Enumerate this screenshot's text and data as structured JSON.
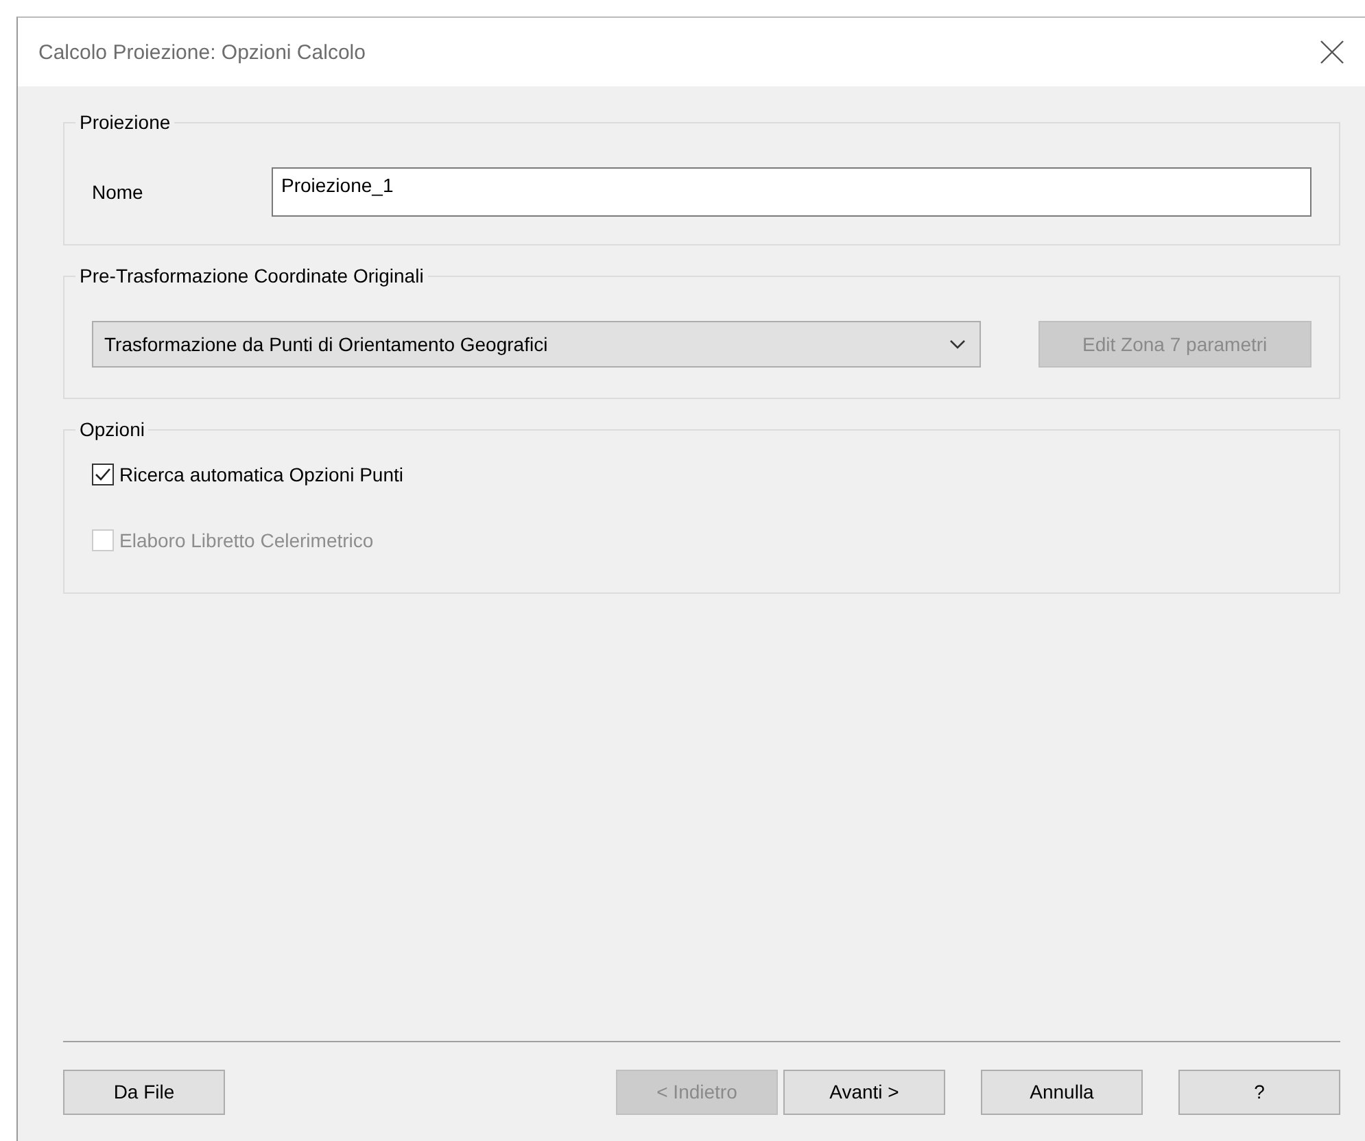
{
  "window": {
    "title": "Calcolo Proiezione: Opzioni Calcolo"
  },
  "proiezione": {
    "label": "Proiezione",
    "name_label": "Nome",
    "name_value": "Proiezione_1"
  },
  "pre_trasformazione": {
    "label": "Pre-Trasformazione Coordinate Originali",
    "selected_option": "Trasformazione da Punti di Orientamento Geografici",
    "edit_button": {
      "label": "Edit Zona 7 parametri",
      "disabled": true
    }
  },
  "opzioni": {
    "label": "Opzioni",
    "checkboxes": [
      {
        "label": "Ricerca automatica Opzioni Punti",
        "checked": true,
        "disabled": false
      },
      {
        "label": "Elaboro Libretto Celerimetrico",
        "checked": false,
        "disabled": true
      }
    ]
  },
  "left_button": {
    "label": "Da File",
    "disabled": false
  },
  "buttons": [
    {
      "label": "< Indietro",
      "disabled": true
    },
    {
      "label": "Avanti >",
      "disabled": false
    },
    {
      "label": "Annulla",
      "disabled": false
    },
    {
      "label": "?",
      "disabled": false
    }
  ]
}
